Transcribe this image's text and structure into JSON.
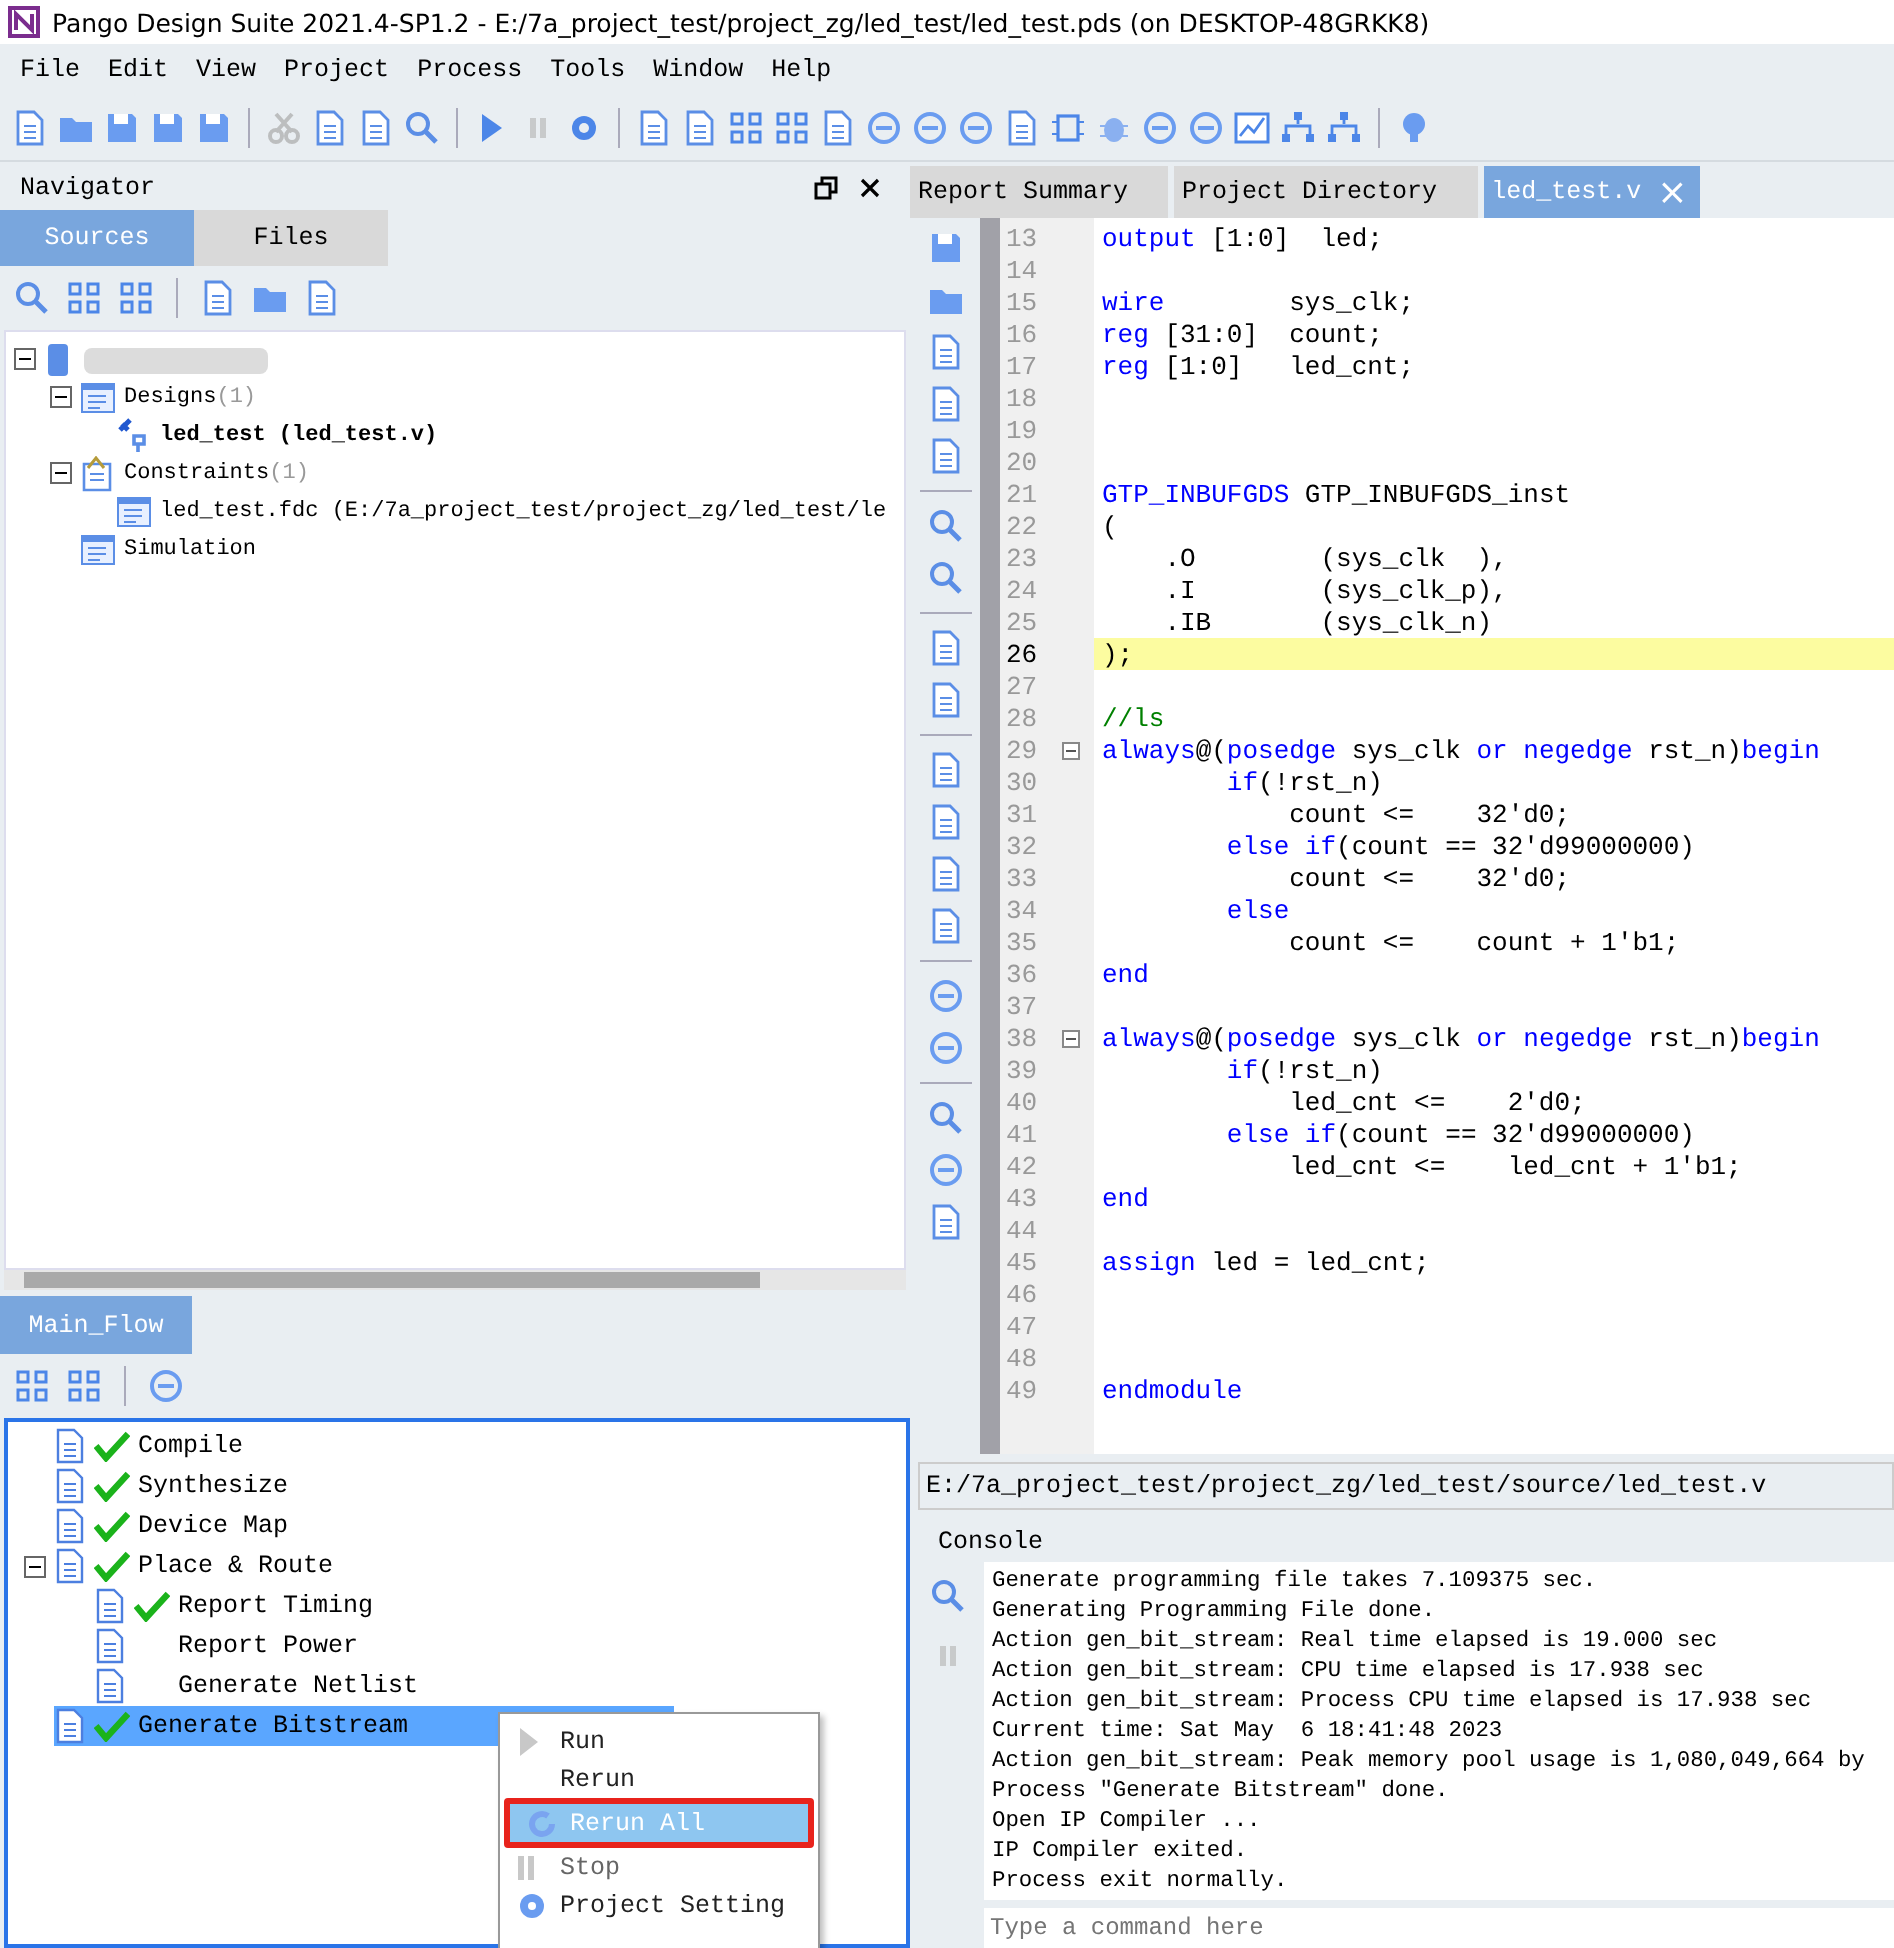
{
  "window": {
    "title": "Pango Design Suite 2021.4-SP1.2 - E:/7a_project_test/project_zg/led_test/led_test.pds (on DESKTOP-48GRKK8)"
  },
  "menu": [
    "File",
    "Edit",
    "View",
    "Project",
    "Process",
    "Tools",
    "Window",
    "Help"
  ],
  "navigator": {
    "title": "Navigator",
    "tabs": [
      {
        "label": "Sources",
        "selected": true
      },
      {
        "label": "Files",
        "selected": false
      }
    ],
    "tree": [
      {
        "kind": "root",
        "expanded": true,
        "children": [
          {
            "kind": "folder",
            "label": "Designs",
            "count": "(1)",
            "expanded": true,
            "children": [
              {
                "kind": "design",
                "label": "led_test  (led_test.v)"
              }
            ]
          },
          {
            "kind": "constraints",
            "label": "Constraints",
            "count": "(1)",
            "expanded": true,
            "children": [
              {
                "kind": "file",
                "label": "led_test.fdc  (E:/7a_project_test/project_zg/led_test/le"
              }
            ]
          },
          {
            "kind": "folder",
            "label": "Simulation"
          }
        ]
      }
    ]
  },
  "flow": {
    "tab": {
      "label": "Main_Flow",
      "selected": true
    },
    "items": [
      {
        "label": "Compile",
        "done": true,
        "selected": false
      },
      {
        "label": "Synthesize",
        "done": true,
        "selected": false
      },
      {
        "label": "Device Map",
        "done": true,
        "selected": false
      },
      {
        "label": "Place & Route",
        "done": true,
        "selected": false,
        "expanded": true,
        "children": [
          {
            "label": "Report Timing",
            "done": true,
            "selected": false
          },
          {
            "label": "Report Power",
            "done": false,
            "selected": false
          },
          {
            "label": "Generate Netlist",
            "done": false,
            "selected": false
          }
        ]
      },
      {
        "label": "Generate Bitstream",
        "done": true,
        "selected": true
      }
    ]
  },
  "context_menu": [
    {
      "label": "Run",
      "kind": "run",
      "disabled": false,
      "selected": false
    },
    {
      "label": "Rerun",
      "kind": "plain",
      "disabled": false,
      "selected": false
    },
    {
      "label": "Rerun All",
      "kind": "rerun",
      "disabled": false,
      "selected": true
    },
    {
      "label": "Stop",
      "kind": "stop",
      "disabled": true,
      "selected": false
    },
    {
      "label": "Project Setting",
      "kind": "setting",
      "disabled": false,
      "selected": false
    }
  ],
  "editor": {
    "tabs": [
      {
        "label": "Report Summary",
        "selected": false
      },
      {
        "label": "Project Directory",
        "selected": false
      },
      {
        "label": "led_test.v",
        "selected": true,
        "close": "×"
      }
    ],
    "lines": [
      {
        "n": "13",
        "segs": [
          {
            "kind": "keyword",
            "text": "output"
          },
          {
            "kind": "text",
            "text": " [1:0]  led;"
          }
        ]
      },
      {
        "n": "14"
      },
      {
        "n": "15",
        "segs": [
          {
            "kind": "keyword",
            "text": "wire"
          },
          {
            "kind": "text",
            "text": "        sys_clk;"
          }
        ]
      },
      {
        "n": "16",
        "segs": [
          {
            "kind": "keyword",
            "text": "reg"
          },
          {
            "kind": "text",
            "text": " [31:0]  count;"
          }
        ]
      },
      {
        "n": "17",
        "segs": [
          {
            "kind": "keyword",
            "text": "reg"
          },
          {
            "kind": "text",
            "text": " [1:0]   led_cnt;"
          }
        ]
      },
      {
        "n": "18"
      },
      {
        "n": "19"
      },
      {
        "n": "20"
      },
      {
        "n": "21",
        "segs": [
          {
            "kind": "keyword",
            "text": "GTP_INBUFGDS"
          },
          {
            "kind": "text",
            "text": " GTP_INBUFGDS_inst"
          }
        ]
      },
      {
        "n": "22",
        "segs": [
          {
            "kind": "text",
            "text": "("
          }
        ]
      },
      {
        "n": "23",
        "segs": [
          {
            "kind": "text",
            "text": "    .O        (sys_clk  ),"
          }
        ]
      },
      {
        "n": "24",
        "segs": [
          {
            "kind": "text",
            "text": "    .I        (sys_clk_p),"
          }
        ]
      },
      {
        "n": "25",
        "segs": [
          {
            "kind": "text",
            "text": "    .IB       (sys_clk_n)"
          }
        ]
      },
      {
        "n": "26",
        "current": true,
        "segs": [
          {
            "kind": "text",
            "text": ");"
          }
        ]
      },
      {
        "n": "27"
      },
      {
        "n": "28",
        "segs": [
          {
            "kind": "comment",
            "text": "//ls"
          }
        ]
      },
      {
        "n": "29",
        "fold": true,
        "segs": [
          {
            "kind": "keyword",
            "text": "always"
          },
          {
            "kind": "text",
            "text": "@("
          },
          {
            "kind": "keyword",
            "text": "posedge"
          },
          {
            "kind": "text",
            "text": " sys_clk "
          },
          {
            "kind": "keyword",
            "text": "or negedge"
          },
          {
            "kind": "text",
            "text": " rst_n)"
          },
          {
            "kind": "keyword",
            "text": "begin"
          }
        ]
      },
      {
        "n": "30",
        "segs": [
          {
            "kind": "keyword",
            "text": "        if"
          },
          {
            "kind": "text",
            "text": "(!rst_n)"
          }
        ]
      },
      {
        "n": "31",
        "segs": [
          {
            "kind": "text",
            "text": "            count <=    32'd0;"
          }
        ]
      },
      {
        "n": "32",
        "segs": [
          {
            "kind": "keyword",
            "text": "        else if"
          },
          {
            "kind": "text",
            "text": "(count == 32'd99000000)"
          }
        ]
      },
      {
        "n": "33",
        "segs": [
          {
            "kind": "text",
            "text": "            count <=    32'd0;"
          }
        ]
      },
      {
        "n": "34",
        "segs": [
          {
            "kind": "keyword",
            "text": "        else"
          }
        ]
      },
      {
        "n": "35",
        "segs": [
          {
            "kind": "text",
            "text": "            count <=    count + 1'b1;"
          }
        ]
      },
      {
        "n": "36",
        "segs": [
          {
            "kind": "keyword",
            "text": "end"
          }
        ]
      },
      {
        "n": "37"
      },
      {
        "n": "38",
        "fold": true,
        "segs": [
          {
            "kind": "keyword",
            "text": "always"
          },
          {
            "kind": "text",
            "text": "@("
          },
          {
            "kind": "keyword",
            "text": "posedge"
          },
          {
            "kind": "text",
            "text": " sys_clk "
          },
          {
            "kind": "keyword",
            "text": "or negedge"
          },
          {
            "kind": "text",
            "text": " rst_n)"
          },
          {
            "kind": "keyword",
            "text": "begin"
          }
        ]
      },
      {
        "n": "39",
        "segs": [
          {
            "kind": "keyword",
            "text": "        if"
          },
          {
            "kind": "text",
            "text": "(!rst_n)"
          }
        ]
      },
      {
        "n": "40",
        "segs": [
          {
            "kind": "text",
            "text": "            led_cnt <=    2'd0;"
          }
        ]
      },
      {
        "n": "41",
        "segs": [
          {
            "kind": "keyword",
            "text": "        else if"
          },
          {
            "kind": "text",
            "text": "(count == 32'd99000000)"
          }
        ]
      },
      {
        "n": "42",
        "segs": [
          {
            "kind": "text",
            "text": "            led_cnt <=    led_cnt + 1'b1;"
          }
        ]
      },
      {
        "n": "43",
        "segs": [
          {
            "kind": "keyword",
            "text": "end"
          }
        ]
      },
      {
        "n": "44"
      },
      {
        "n": "45",
        "segs": [
          {
            "kind": "keyword",
            "text": "assign"
          },
          {
            "kind": "text",
            "text": " led = led_cnt;"
          }
        ]
      },
      {
        "n": "46"
      },
      {
        "n": "47"
      },
      {
        "n": "48"
      },
      {
        "n": "49",
        "segs": [
          {
            "kind": "keyword",
            "text": "endmodule"
          }
        ]
      }
    ]
  },
  "file_path": "E:/7a_project_test/project_zg/led_test/source/led_test.v",
  "console": {
    "title": "Console",
    "lines": [
      "Generate programming file takes 7.109375 sec.",
      "Generating Programming File done.",
      "Action gen_bit_stream: Real time elapsed is 19.000 sec",
      "Action gen_bit_stream: CPU time elapsed is 17.938 sec",
      "Action gen_bit_stream: Process CPU time elapsed is 17.938 sec",
      "Current time: Sat May  6 18:41:48 2023",
      "Action gen_bit_stream: Peak memory pool usage is 1,080,049,664 by",
      "Process \"Generate Bitstream\" done.",
      "Open IP Compiler ...",
      "IP Compiler exited.",
      "Process exit normally."
    ],
    "placeholder": "Type a command here"
  }
}
